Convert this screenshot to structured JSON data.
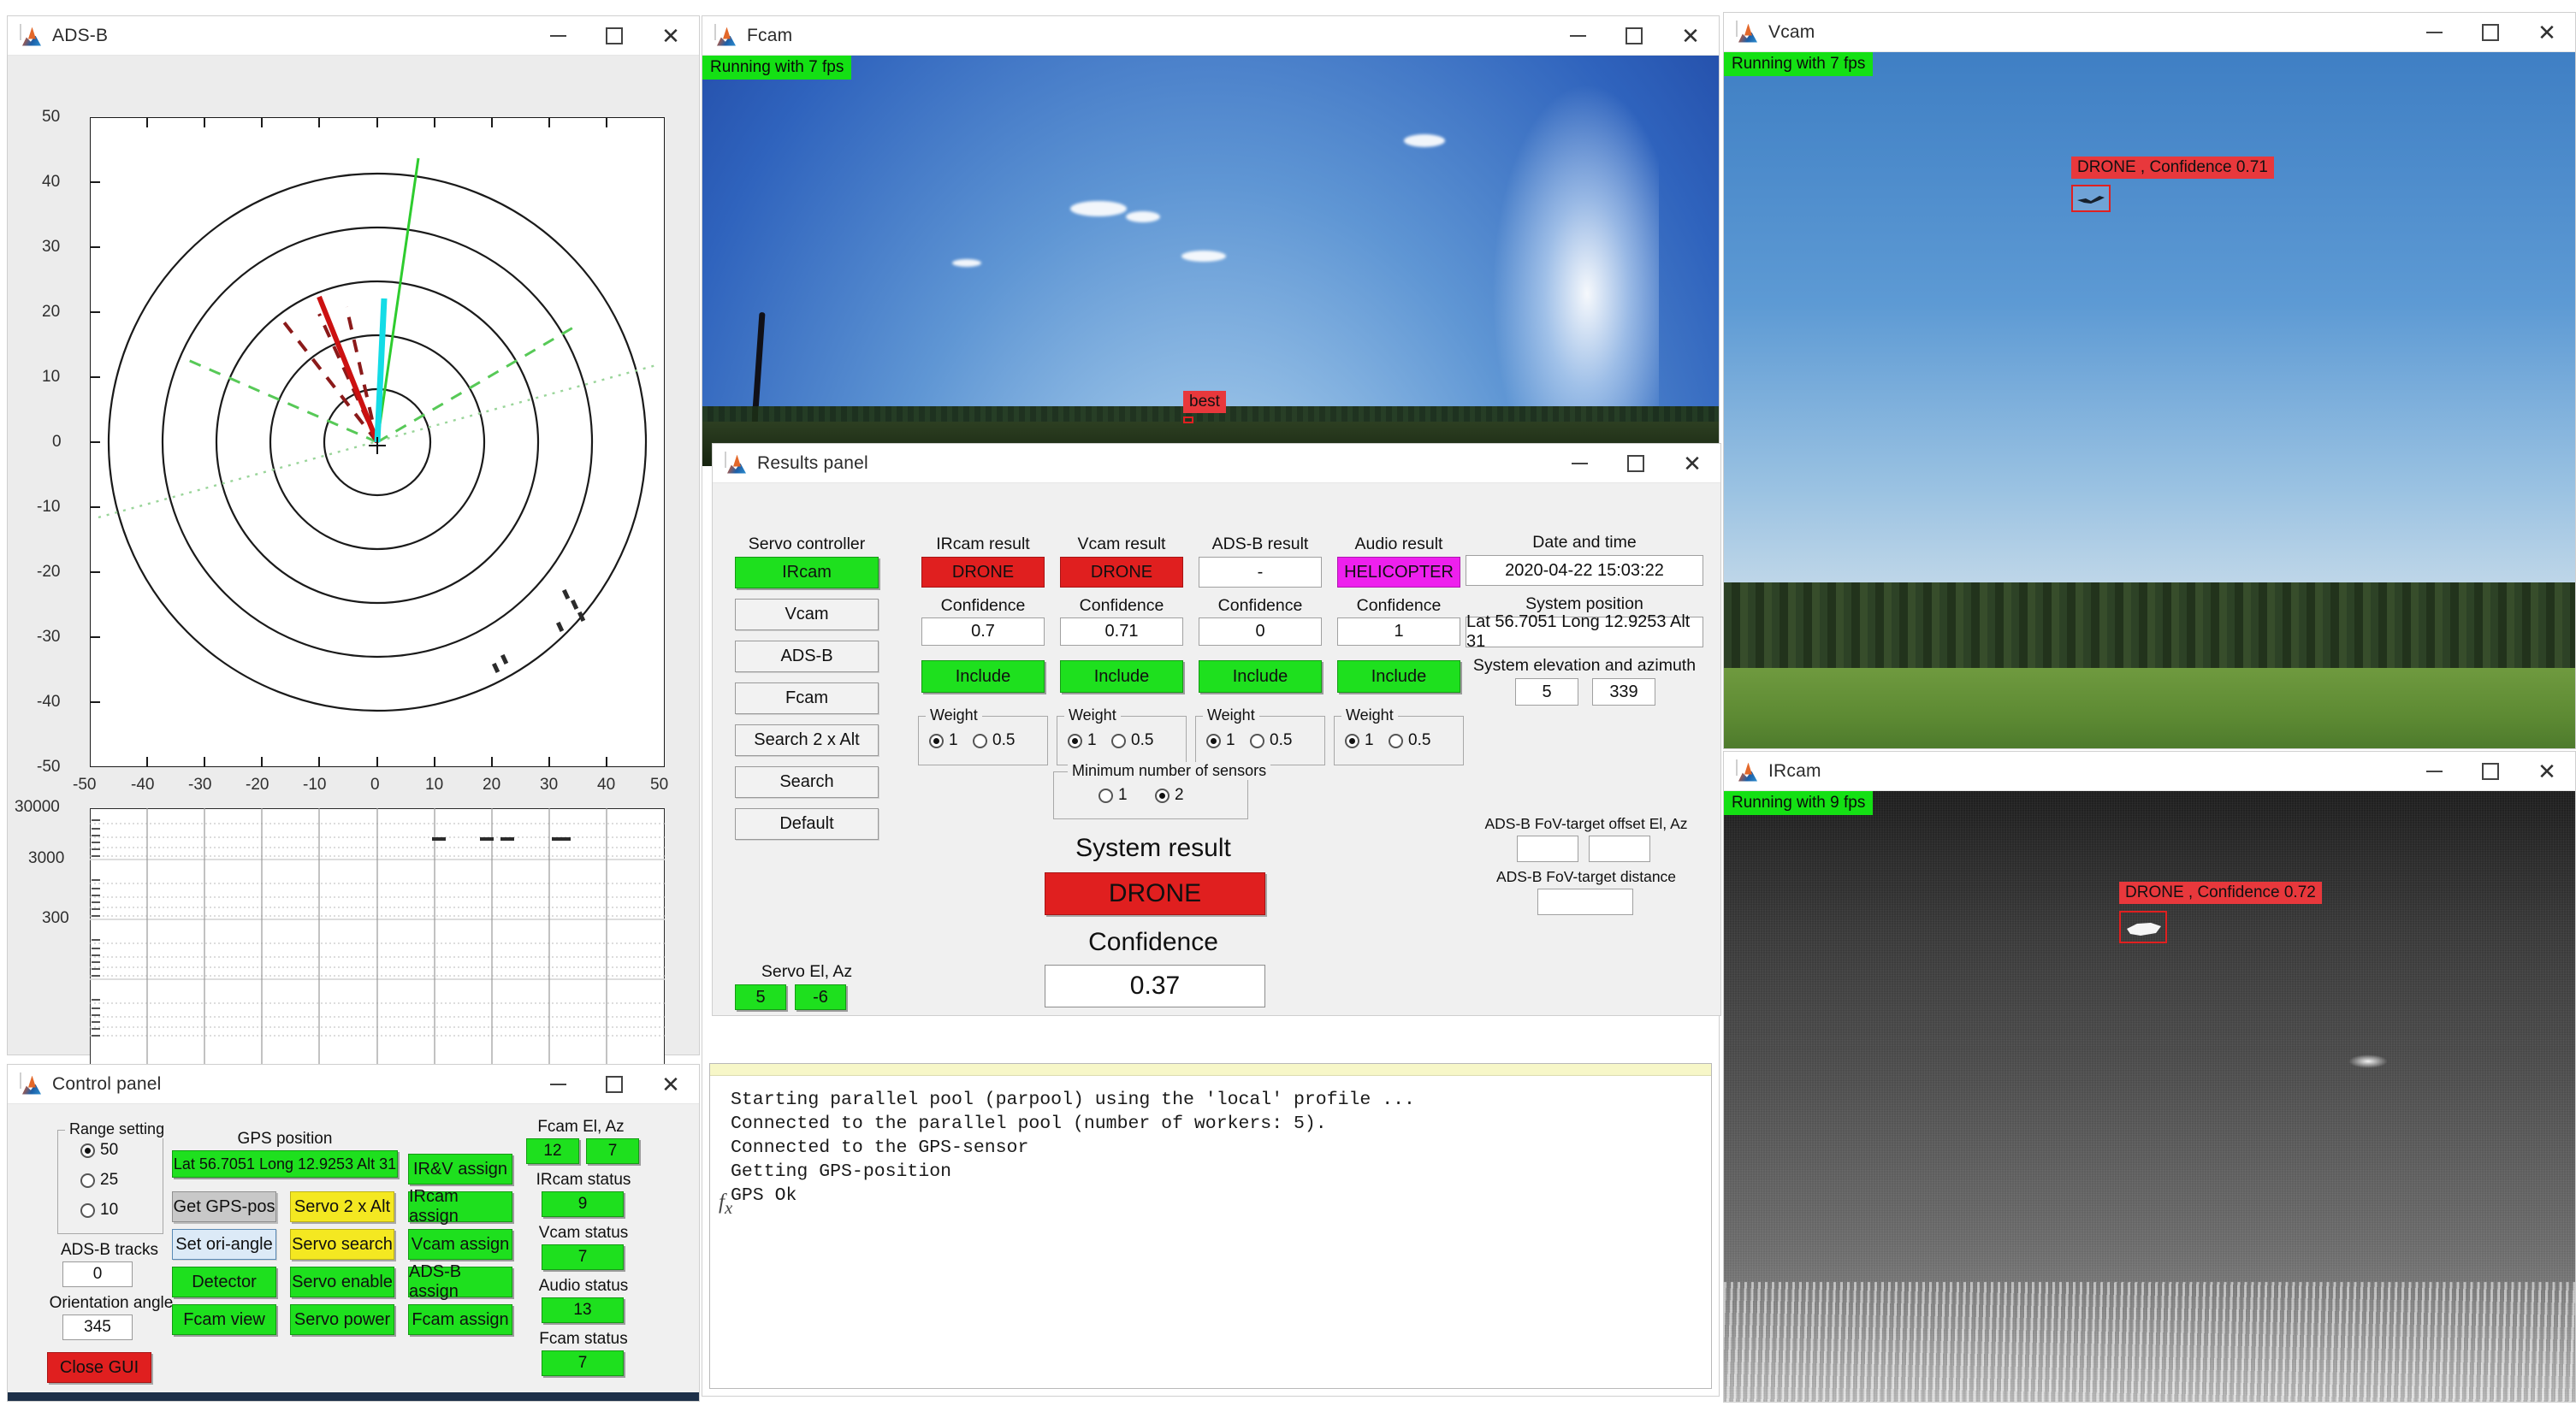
{
  "windows": {
    "adsb": {
      "title": "ADS-B",
      "icon": "matlab-membrane-icon"
    },
    "fcam": {
      "title": "Fcam",
      "icon": "matlab-membrane-icon",
      "fps_badge": "Running with 7 fps"
    },
    "vcam": {
      "title": "Vcam",
      "icon": "matlab-membrane-icon",
      "fps_badge": "Running with 7 fps"
    },
    "ircam": {
      "title": "IRcam",
      "icon": "matlab-membrane-icon",
      "fps_badge": "Running with 9 fps"
    },
    "results": {
      "title": "Results panel",
      "icon": "matlab-membrane-icon"
    },
    "control": {
      "title": "Control panel",
      "icon": "matlab-membrane-icon"
    }
  },
  "titlebar_buttons": {
    "minimize": "minimize-icon",
    "maximize": "maximize-icon",
    "close": "close-icon"
  },
  "chart_data": [
    {
      "type": "scatter",
      "name": "adsb-polar-range-plot",
      "title": "",
      "xlabel": "",
      "ylabel": "",
      "xlim": [
        -50,
        50
      ],
      "ylim": [
        -50,
        50
      ],
      "xticks": [
        -50,
        -40,
        -30,
        -20,
        -10,
        0,
        10,
        20,
        30,
        40,
        50
      ],
      "yticks": [
        -50,
        -40,
        -30,
        -20,
        -10,
        0,
        10,
        20,
        30,
        40,
        50
      ],
      "grid": false,
      "range_rings": [
        10,
        20,
        30,
        40,
        50
      ],
      "series": [
        {
          "name": "fcam-fov",
          "color": "#2ecc2e",
          "style": "solid",
          "points": [
            [
              0,
              0
            ],
            [
              7,
              50
            ]
          ]
        },
        {
          "name": "vcam-track",
          "color": "#14dce6",
          "style": "solid",
          "points": [
            [
              0,
              0
            ],
            [
              1,
              24
            ]
          ]
        },
        {
          "name": "ircam-track",
          "color": "#cc1111",
          "style": "solid",
          "points": [
            [
              0,
              0
            ],
            [
              -6,
              22
            ]
          ]
        },
        {
          "name": "ircam-fov-dashed",
          "color": "#8b1a1a",
          "style": "dashed",
          "points": [
            [
              0,
              0
            ],
            [
              -10,
              21
            ]
          ]
        },
        {
          "name": "ircam-fov-dashed-2",
          "color": "#8b1a1a",
          "style": "dashed",
          "points": [
            [
              0,
              0
            ],
            [
              -2,
              22
            ]
          ]
        },
        {
          "name": "servo-fov-left",
          "color": "#57c957",
          "style": "dashed",
          "points": [
            [
              0,
              0
            ],
            [
              -34,
              14
            ]
          ]
        },
        {
          "name": "servo-fov-right",
          "color": "#57c957",
          "style": "dashed",
          "points": [
            [
              0,
              0
            ],
            [
              35,
              20
            ]
          ]
        },
        {
          "name": "orientation-axis",
          "color": "#9ad59a",
          "style": "dotted",
          "points": [
            [
              -48,
              -13
            ],
            [
              49,
              14
            ]
          ]
        }
      ],
      "markers": [
        {
          "x": 32,
          "y": -27,
          "color": "#2b2b2b"
        },
        {
          "x": 34,
          "y": -28,
          "color": "#2b2b2b"
        },
        {
          "x": 35,
          "y": -30,
          "color": "#2b2b2b"
        },
        {
          "x": 30,
          "y": -32,
          "color": "#2b2b2b"
        },
        {
          "x": 14,
          "y": -38,
          "color": "#2b2b2b"
        },
        {
          "x": 12,
          "y": -39,
          "color": "#2b2b2b"
        }
      ]
    },
    {
      "type": "scatter",
      "name": "adsb-altitude-plot",
      "title": "",
      "xlabel": "",
      "ylabel": "",
      "xlim": [
        -50,
        50
      ],
      "ylim": [
        30,
        30000
      ],
      "yscale": "log",
      "xticks": [
        -50,
        -40,
        -30,
        -20,
        -10,
        0,
        10,
        20,
        30,
        40,
        50
      ],
      "yticks": [
        300,
        3000,
        30000
      ],
      "ytick_labels": [
        "300",
        "3000",
        "30000"
      ],
      "grid": true,
      "series": [
        {
          "name": "adsb-altitude-marks",
          "color": "#2b2b2b",
          "style": "dash-marks",
          "points": [
            [
              10,
              12000
            ],
            [
              19,
              12000
            ],
            [
              23,
              12000
            ],
            [
              30,
              12000
            ]
          ]
        }
      ]
    }
  ],
  "fcam": {
    "detection_label": "best"
  },
  "vcam": {
    "detection_label": "DRONE , Confidence 0.71"
  },
  "ircam": {
    "detection_label": "DRONE , Confidence 0.72"
  },
  "results": {
    "servo_controller": {
      "label": "Servo controller",
      "buttons": [
        {
          "label": "IRcam",
          "state": "active"
        },
        {
          "label": "Vcam",
          "state": "normal"
        },
        {
          "label": "ADS-B",
          "state": "normal"
        },
        {
          "label": "Fcam",
          "state": "normal"
        },
        {
          "label": "Search 2 x Alt",
          "state": "normal"
        },
        {
          "label": "Search",
          "state": "normal"
        },
        {
          "label": "Default",
          "state": "normal"
        }
      ]
    },
    "sensors": [
      {
        "result_label": "IRcam result",
        "result_value": "DRONE",
        "result_color": "#e01f1f",
        "confidence_label": "Confidence",
        "confidence_value": "0.7",
        "include_label": "Include",
        "weight_label": "Weight",
        "weight_options": [
          "1",
          "0.5"
        ],
        "weight_selected": "1"
      },
      {
        "result_label": "Vcam result",
        "result_value": "DRONE",
        "result_color": "#e01f1f",
        "confidence_label": "Confidence",
        "confidence_value": "0.71",
        "include_label": "Include",
        "weight_label": "Weight",
        "weight_options": [
          "1",
          "0.5"
        ],
        "weight_selected": "1"
      },
      {
        "result_label": "ADS-B result",
        "result_value": "-",
        "result_color": "#ffffff",
        "confidence_label": "Confidence",
        "confidence_value": "0",
        "include_label": "Include",
        "weight_label": "Weight",
        "weight_options": [
          "1",
          "0.5"
        ],
        "weight_selected": "1"
      },
      {
        "result_label": "Audio result",
        "result_value": "HELICOPTER",
        "result_color": "#ee20ee",
        "confidence_label": "Confidence",
        "confidence_value": "1",
        "include_label": "Include",
        "weight_label": "Weight",
        "weight_options": [
          "1",
          "0.5"
        ],
        "weight_selected": "1"
      }
    ],
    "min_sensors": {
      "label": "Minimum number of sensors",
      "options": [
        "1",
        "2"
      ],
      "selected": "2"
    },
    "system_result": {
      "label": "System result",
      "value": "DRONE",
      "color": "#e01f1f"
    },
    "confidence": {
      "label": "Confidence",
      "value": "0.37"
    },
    "date_time": {
      "label": "Date and time",
      "value": "2020-04-22    15:03:22"
    },
    "system_position": {
      "label": "System position",
      "value": "Lat 56.7051 Long 12.9253 Alt 31"
    },
    "system_el_az": {
      "label": "System elevation and azimuth",
      "elevation": "5",
      "azimuth": "339"
    },
    "fov_offset": {
      "label": "ADS-B FoV-target offset El, Az",
      "elevation": "",
      "azimuth": ""
    },
    "fov_distance": {
      "label": "ADS-B FoV-target distance",
      "value": ""
    },
    "servo_el_az": {
      "label": "Servo El, Az",
      "elevation": "5",
      "azimuth": "-6"
    }
  },
  "console": {
    "lines": [
      "Starting parallel pool (parpool) using the 'local' profile ...",
      "Connected to the parallel pool (number of workers: 5).",
      "Connected to the GPS-sensor",
      "Getting GPS-position",
      "GPS Ok"
    ],
    "prompt_icon": "fx-icon"
  },
  "control": {
    "range_setting": {
      "label": "Range setting",
      "options": [
        "50",
        "25",
        "10"
      ],
      "selected": "50"
    },
    "adsb_tracks": {
      "label": "ADS-B tracks",
      "value": "0"
    },
    "orientation_angle": {
      "label": "Orientation angle",
      "value": "345"
    },
    "gps_position": {
      "label": "GPS position",
      "value": "Lat 56.7051 Long 12.9253 Alt 31"
    },
    "buttons": [
      {
        "label": "Get GPS-pos",
        "color": "gray"
      },
      {
        "label": "Set ori-angle",
        "color": "blue"
      },
      {
        "label": "Detector",
        "color": "green"
      },
      {
        "label": "Fcam view",
        "color": "green"
      },
      {
        "label": "Close GUI",
        "color": "red"
      },
      {
        "label": "Servo 2 x Alt",
        "color": "yellow"
      },
      {
        "label": "Servo search",
        "color": "yellow"
      },
      {
        "label": "Servo enable",
        "color": "green"
      },
      {
        "label": "Servo power",
        "color": "green"
      },
      {
        "label": "IR&V assign",
        "color": "green"
      },
      {
        "label": "IRcam assign",
        "color": "green"
      },
      {
        "label": "Vcam assign",
        "color": "green"
      },
      {
        "label": "ADS-B assign",
        "color": "green"
      },
      {
        "label": "Fcam assign",
        "color": "green"
      }
    ],
    "fcam_el_az": {
      "label": "Fcam El, Az",
      "elevation": "12",
      "azimuth": "7"
    },
    "statuses": [
      {
        "label": "IRcam status",
        "value": "9"
      },
      {
        "label": "Vcam status",
        "value": "7"
      },
      {
        "label": "Audio status",
        "value": "13"
      },
      {
        "label": "Fcam status",
        "value": "7"
      }
    ]
  }
}
